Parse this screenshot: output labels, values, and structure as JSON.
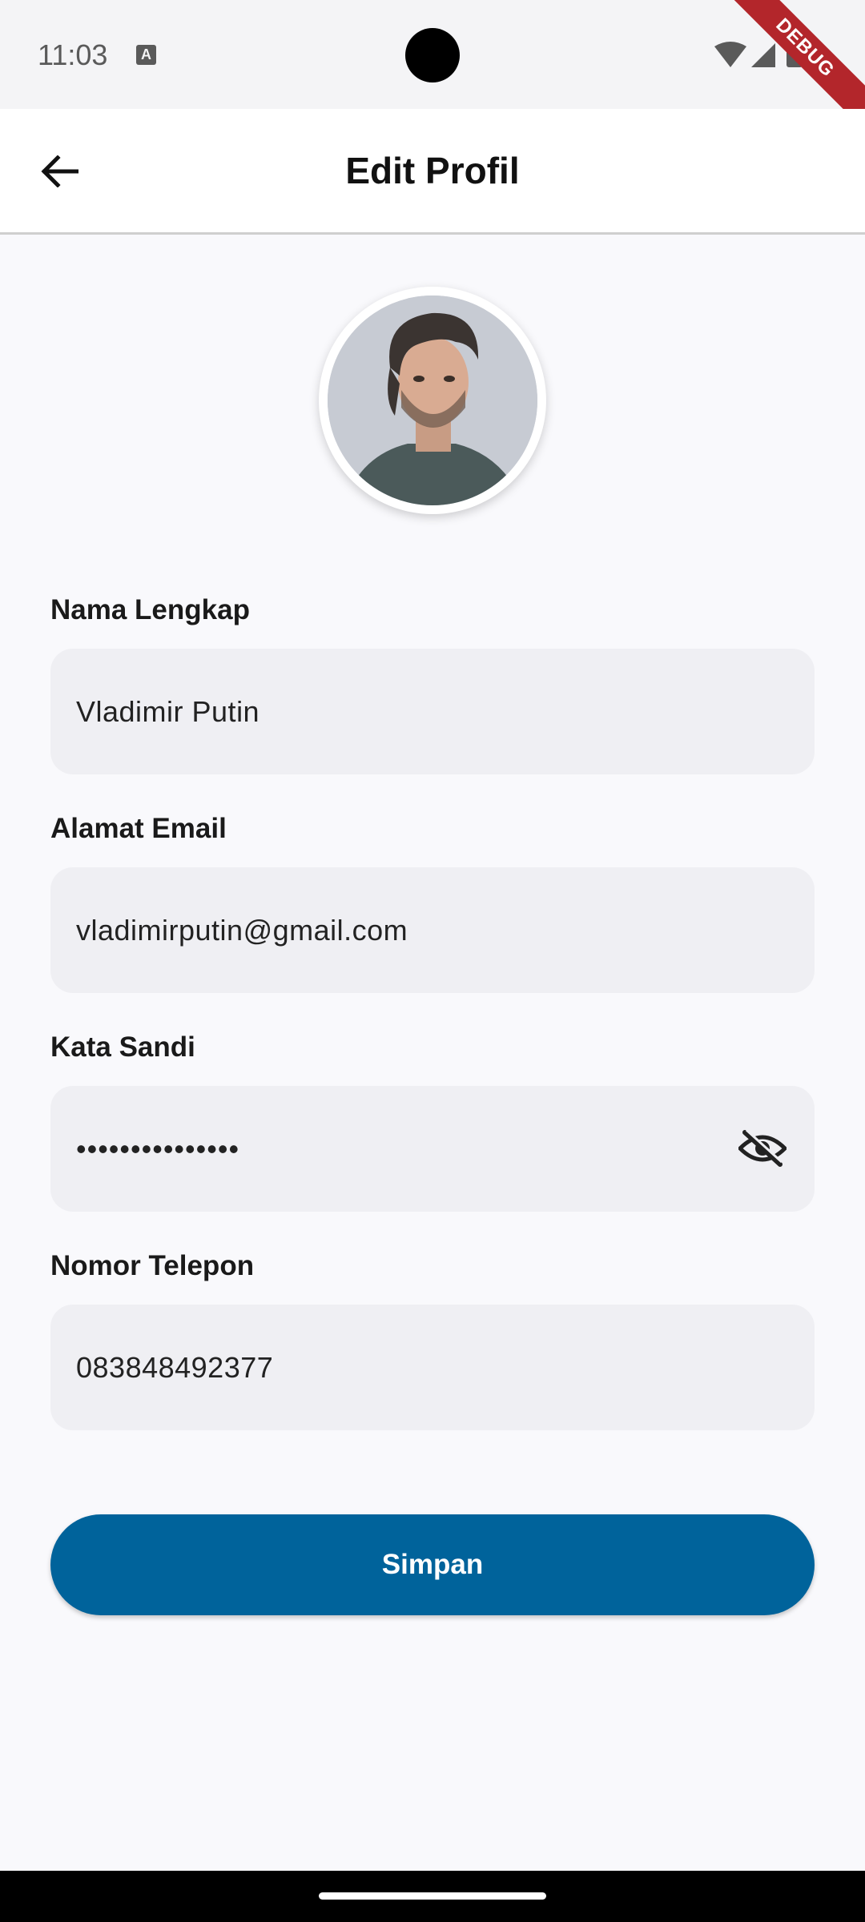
{
  "status_bar": {
    "time": "11:03",
    "icons": [
      "a-notification-icon",
      "wifi-icon",
      "signal-icon",
      "battery-icon"
    ],
    "debug_label": "DEBUG"
  },
  "app_bar": {
    "title": "Edit Profil",
    "back_icon": "arrow-left-icon"
  },
  "form": {
    "fields": [
      {
        "label": "Nama Lengkap",
        "value": "Vladimir Putin"
      },
      {
        "label": "Alamat Email",
        "value": "vladimirputin@gmail.com"
      },
      {
        "label": "Kata Sandi",
        "value": "•••••••••••••••",
        "toggle_icon": "visibility-off-icon"
      },
      {
        "label": "Nomor Telepon",
        "value": "083848492377"
      }
    ],
    "save_label": "Simpan"
  },
  "colors": {
    "primary": "#00639b",
    "field_bg": "#efeff3",
    "page_bg": "#f9f9fc",
    "debug_banner": "#b3262b"
  }
}
